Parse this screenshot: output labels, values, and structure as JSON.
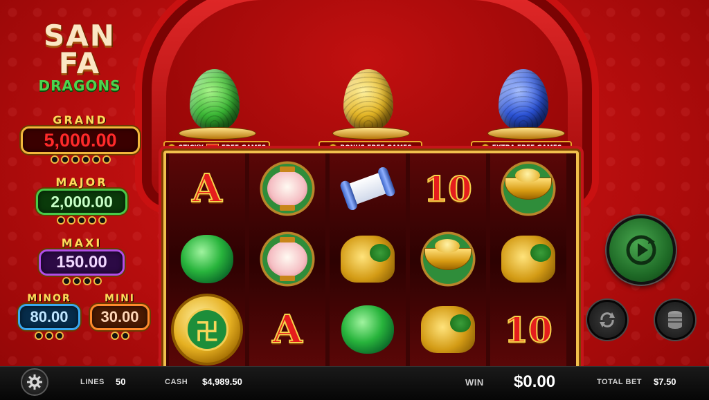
{
  "logo": {
    "line1": "SAN",
    "line2": "FA",
    "line3": "DRAGONS"
  },
  "jackpots": [
    {
      "label": "GRAND",
      "value": "5,000.00",
      "color": "#e0151f"
    },
    {
      "label": "MAJOR",
      "value": "2,000.00",
      "color": "#3fd43f"
    },
    {
      "label": "MAXI",
      "value": "150.00",
      "color": "#c650ff"
    },
    {
      "label": "MINOR",
      "value": "80.00",
      "color": "#3fb6ff"
    },
    {
      "label": "MINI",
      "value": "30.00",
      "color": "#ff7a2a"
    }
  ],
  "features": [
    {
      "label_left": "STICKY",
      "label_right": "FREE GAMES",
      "egg_color": "#39b634",
      "icon": "green-dragon-egg-icon"
    },
    {
      "label": "BONUS FREE GAMES",
      "egg_color": "#e3b423",
      "icon": "gold-dragon-egg-icon"
    },
    {
      "label": "EXTRA FREE GAMES",
      "egg_color": "#2a52d6",
      "icon": "blue-dragon-egg-icon"
    }
  ],
  "reels": [
    [
      "A",
      "jade",
      "coin"
    ],
    [
      "lantern",
      "lantern",
      "A"
    ],
    [
      "scroll",
      "turtle",
      "jade"
    ],
    [
      "10",
      "ingot",
      "turtle"
    ],
    [
      "ingot",
      "turtle",
      "10"
    ]
  ],
  "controls": {
    "spin_icon": "spin-play-icon",
    "autoplay_icon": "autoplay-refresh-icon",
    "bet_icon": "coin-stack-icon",
    "settings_icon": "gear-icon"
  },
  "status": {
    "lines_label": "LINES",
    "lines_value": "50",
    "cash_label": "CASH",
    "cash_value": "$4,989.50",
    "win_label": "WIN",
    "win_value": "$0.00",
    "total_bet_label": "TOTAL BET",
    "total_bet_value": "$7.50"
  }
}
